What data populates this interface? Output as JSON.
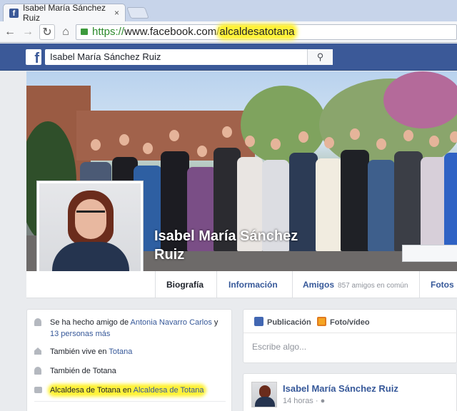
{
  "browser": {
    "tab_title": "Isabel María Sánchez Ruiz",
    "tab_close": "×",
    "url_proto": "https://",
    "url_host": "www.facebook.com/",
    "url_path": "alcaldesatotana"
  },
  "fb": {
    "logo": "f",
    "search_value": "Isabel María Sánchez Ruiz"
  },
  "profile": {
    "name_line1": "Isabel María Sánchez",
    "name_line2": "Ruiz"
  },
  "nav": {
    "tabs": [
      {
        "label": "Biografía"
      },
      {
        "label": "Información"
      },
      {
        "label": "Amigos"
      },
      {
        "label": "Fotos"
      }
    ],
    "friends_common": "857 amigos en común"
  },
  "intro": {
    "friend_prefix": "Se ha hecho amigo de ",
    "friend_name": "Antonia Navarro Carlos",
    "friend_and": " y",
    "friend_more": "13 personas más",
    "lives_prefix": "También vive en ",
    "lives_place": "Totana",
    "from_text": "También de Totana",
    "job_title": "Alcaldesa de Totana",
    "job_en": " en ",
    "job_org": "Alcaldesa de Totana"
  },
  "composer": {
    "tab_post": "Publicación",
    "tab_photo": "Foto/vídeo",
    "placeholder": "Escribe algo..."
  },
  "post": {
    "author": "Isabel María Sánchez Ruiz",
    "time": "14 horas · "
  },
  "colors": {
    "fb_blue": "#3b5998",
    "link": "#365899",
    "highlight": "#fff23a"
  }
}
